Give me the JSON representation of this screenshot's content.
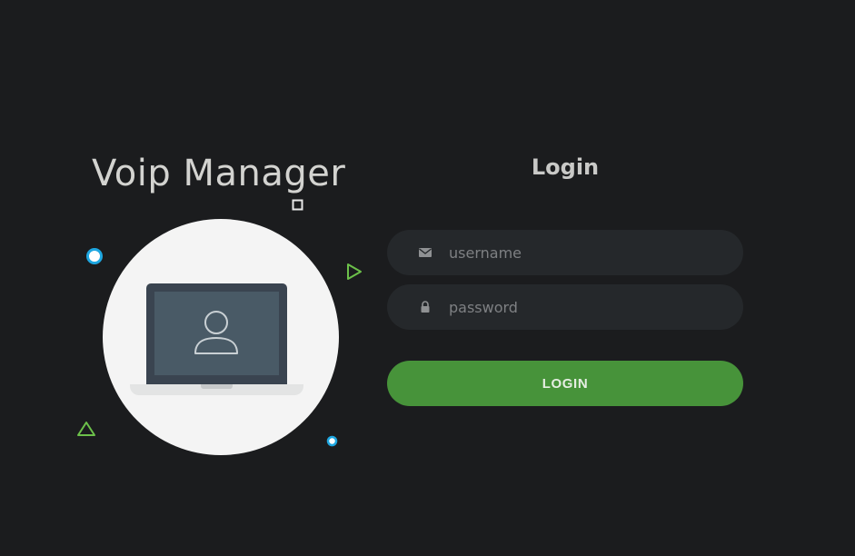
{
  "brand": {
    "title": "Voip Manager"
  },
  "illustration": {
    "icons": [
      "laptop-icon",
      "user-icon"
    ]
  },
  "login": {
    "heading": "Login",
    "username": {
      "placeholder": "username",
      "value": "",
      "icon": "envelope-icon"
    },
    "password": {
      "placeholder": "password",
      "value": "",
      "icon": "lock-icon"
    },
    "button_label": "LOGIN"
  },
  "colors": {
    "background": "#1b1c1e",
    "field_background": "#25282b",
    "button": "#47933a",
    "accent_blue": "#1ea7e1",
    "accent_green": "#6cc04a"
  }
}
